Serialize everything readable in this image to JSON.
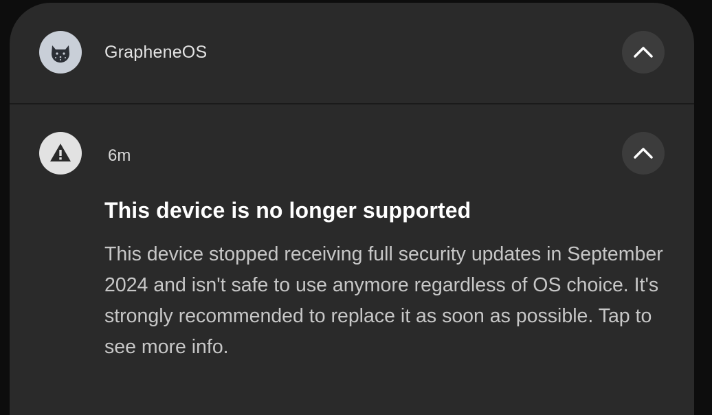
{
  "group": {
    "app_name": "GrapheneOS",
    "icon": "graphene-cat-icon",
    "expand_icon": "chevron-up-icon"
  },
  "notification": {
    "icon": "warning-icon",
    "timestamp": "6m",
    "title": "This device is no longer supported",
    "body": "This device stopped receiving full security updates in September 2024 and isn't safe to use anymore regardless of OS choice. It's strongly recommended to replace it as soon as possible. Tap to see more info.",
    "expand_icon": "chevron-up-icon"
  },
  "colors": {
    "panel_bg": "#2a2a2a",
    "button_bg": "#3c3c3c",
    "title_text": "#ffffff",
    "body_text": "#c7c7c7"
  }
}
